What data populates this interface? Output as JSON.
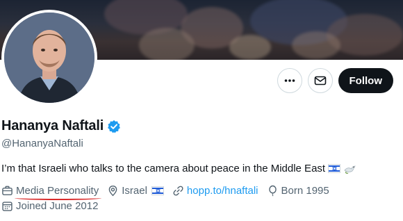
{
  "profile": {
    "name": "Hananya Naftali",
    "handle": "@HananyaNaftali",
    "verified": true,
    "bio": "I’m that Israeli who talks to the camera about peace in the Middle East",
    "bio_emojis": [
      "flag-israel-icon",
      "dove-icon"
    ],
    "category": "Media Personality",
    "location": "Israel",
    "website": "hopp.to/hnaftali",
    "born": "Born 1995",
    "joined": "Joined June 2012"
  },
  "actions": {
    "follow_label": "Follow",
    "more_icon": "more-icon",
    "message_icon": "mail-icon"
  },
  "colors": {
    "accent": "#1d9bf0",
    "follow_bg": "#0f1419",
    "muted_text": "#536471",
    "annotation_underline": "#d92b2b"
  }
}
